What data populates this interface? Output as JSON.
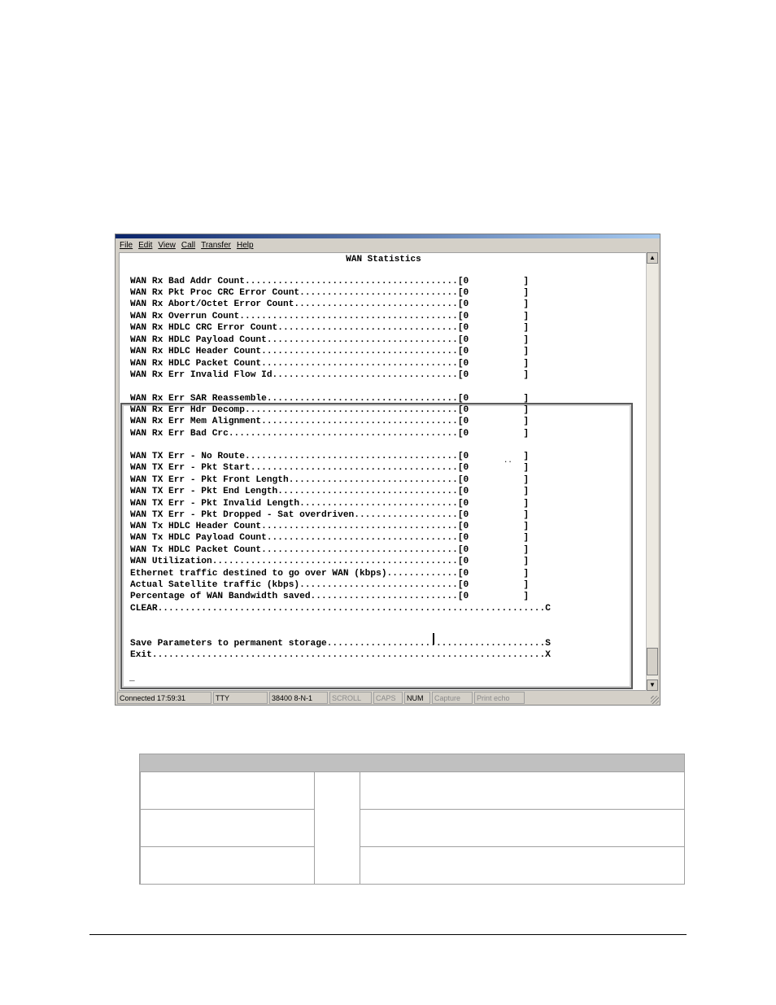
{
  "menu": [
    "File",
    "Edit",
    "View",
    "Call",
    "Transfer",
    "Help"
  ],
  "screen_title": "WAN Statistics",
  "stats_top": [
    "WAN Rx Bad Addr Count.......................................[0          ]",
    "WAN Rx Pkt Proc CRC Error Count.............................[0          ]",
    "WAN Rx Abort/Octet Error Count..............................[0          ]",
    "WAN Rx Overrun Count........................................[0          ]",
    "WAN Rx HDLC CRC Error Count.................................[0          ]",
    "WAN Rx HDLC Payload Count...................................[0          ]",
    "WAN Rx HDLC Header Count....................................[0          ]",
    "WAN Rx HDLC Packet Count....................................[0          ]",
    "WAN Rx Err Invalid Flow Id..................................[0          ]"
  ],
  "stats_rx_err": [
    "WAN Rx Err SAR Reassemble...................................[0          ]",
    "WAN Rx Err Hdr Decomp.......................................[0          ]",
    "WAN Rx Err Mem Alignment....................................[0          ]",
    "WAN Rx Err Bad Crc..........................................[0          ]"
  ],
  "separator_dots": "..",
  "stats_tx": [
    "WAN TX Err - No Route.......................................[0          ]",
    "WAN TX Err - Pkt Start......................................[0          ]",
    "WAN TX Err - Pkt Front Length...............................[0          ]",
    "WAN TX Err - Pkt End Length.................................[0          ]",
    "WAN TX Err - Pkt Invalid Length.............................[0          ]",
    "WAN TX Err - Pkt Dropped - Sat overdriven...................[0          ]",
    "WAN Tx HDLC Header Count....................................[0          ]",
    "WAN Tx HDLC Payload Count...................................[0          ]",
    "WAN Tx HDLC Packet Count....................................[0          ]",
    "WAN Utilization.............................................[0          ]",
    "Ethernet traffic destined to go over WAN (kbps).............[0          ]",
    "Actual Satellite traffic (kbps).............................[0          ]",
    "Percentage of WAN Bandwidth saved...........................[0          ]"
  ],
  "clear_line": "CLEAR.......................................................................C",
  "save_line": "Save Parameters to permanent storage........................................S",
  "exit_line": "Exit........................................................................X",
  "prompt": "_",
  "status": {
    "connected": "Connected 17:59:31",
    "emulation": "TTY",
    "port": "38400 8-N-1",
    "scroll": "SCROLL",
    "caps": "CAPS",
    "num": "NUM",
    "capture": "Capture",
    "print_echo": "Print echo"
  }
}
